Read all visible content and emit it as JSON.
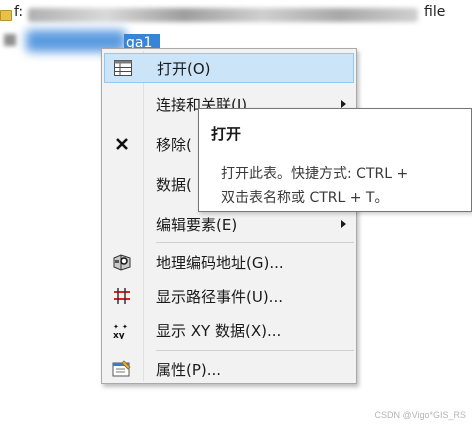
{
  "tree": {
    "path_prefix": "f:",
    "path_suffix": "file",
    "layer_label": "ga1"
  },
  "menu": {
    "items": [
      {
        "label": "打开(O)",
        "icon": "table-icon"
      },
      {
        "label": "连接和关联(J)",
        "icon": "none"
      },
      {
        "label": "移除(",
        "icon": "remove-icon"
      },
      {
        "label": "数据(",
        "icon": "none"
      },
      {
        "label": "编辑要素(E)",
        "icon": "none"
      },
      {
        "label": "地理编码地址(G)...",
        "icon": "geocode-icon"
      },
      {
        "label": "显示路径事件(U)...",
        "icon": "route-events-icon"
      },
      {
        "label": "显示 XY 数据(X)...",
        "icon": "xy-data-icon"
      },
      {
        "label": "属性(P)...",
        "icon": "properties-icon"
      }
    ]
  },
  "tooltip": {
    "title": "打开",
    "line1": "打开此表。快捷方式: CTRL +",
    "line2": "双击表名称或 CTRL + T。"
  },
  "watermark": "CSDN @Vigo*GIS_RS",
  "colors": {
    "hover_bg": "#cce4f7",
    "hover_border": "#90c8f6",
    "menu_bg": "#f2f2f2",
    "selection_blue": "#3a84d6"
  }
}
